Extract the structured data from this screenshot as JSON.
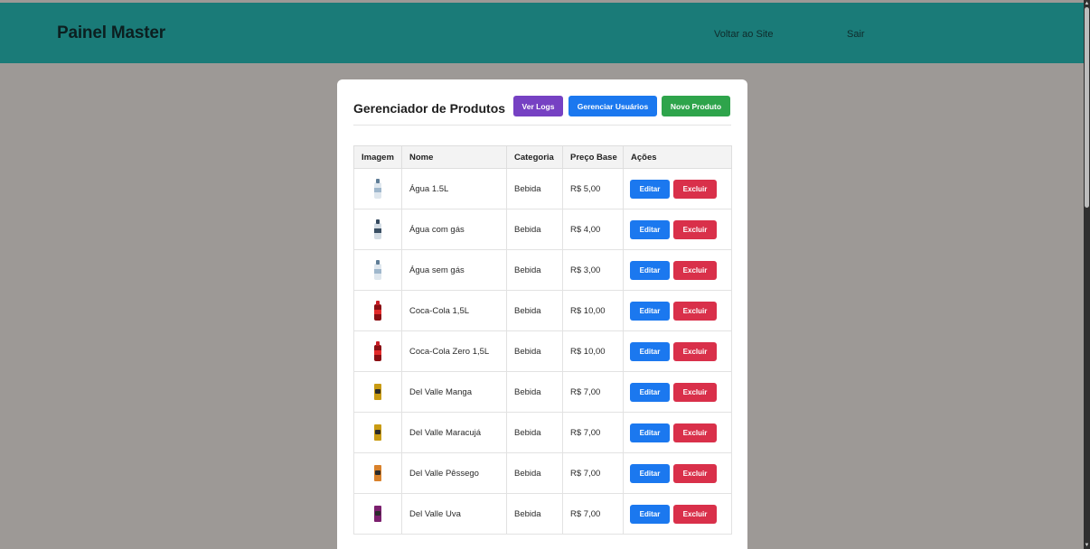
{
  "header": {
    "brand": "Painel Master",
    "links": {
      "back": "Voltar ao Site",
      "exit": "Sair"
    }
  },
  "card": {
    "title": "Gerenciador de Produtos",
    "buttons": {
      "logs": "Ver Logs",
      "users": "Gerenciar Usuários",
      "new": "Novo Produto"
    }
  },
  "table": {
    "columns": [
      "Imagem",
      "Nome",
      "Categoria",
      "Preço Base",
      "Ações"
    ],
    "edit_label": "Editar",
    "delete_label": "Excluir",
    "rows": [
      {
        "name": "Água 1.5L",
        "category": "Bebida",
        "price": "R$ 5,00",
        "icon": "water-bottle-icon"
      },
      {
        "name": "Água com gás",
        "category": "Bebida",
        "price": "R$ 4,00",
        "icon": "sparkling-water-bottle-icon"
      },
      {
        "name": "Água sem gás",
        "category": "Bebida",
        "price": "R$ 3,00",
        "icon": "water-bottle-icon"
      },
      {
        "name": "Coca-Cola 1,5L",
        "category": "Bebida",
        "price": "R$ 10,00",
        "icon": "cola-bottle-icon"
      },
      {
        "name": "Coca-Cola Zero 1,5L",
        "category": "Bebida",
        "price": "R$ 10,00",
        "icon": "cola-bottle-icon"
      },
      {
        "name": "Del Valle Manga",
        "category": "Bebida",
        "price": "R$ 7,00",
        "icon": "juice-can-icon"
      },
      {
        "name": "Del Valle Maracujá",
        "category": "Bebida",
        "price": "R$ 7,00",
        "icon": "juice-can-icon"
      },
      {
        "name": "Del Valle Pêssego",
        "category": "Bebida",
        "price": "R$ 7,00",
        "icon": "juice-can-icon"
      },
      {
        "name": "Del Valle Uva",
        "category": "Bebida",
        "price": "R$ 7,00",
        "icon": "juice-can-icon"
      }
    ]
  },
  "colors": {
    "header_bg": "#1a7b78",
    "page_bg": "#9d9996",
    "logs_btn": "#7641c3",
    "primary_btn": "#1b78ef",
    "success_btn": "#2ea44b",
    "danger_btn": "#d9304a"
  }
}
